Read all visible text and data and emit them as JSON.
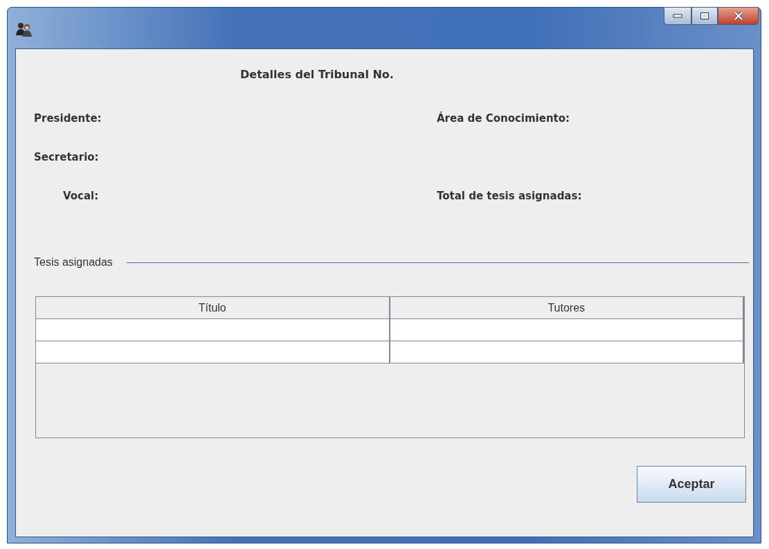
{
  "window": {
    "title_bar_buttons": [
      {
        "kind": "minimize"
      },
      {
        "kind": "maximize"
      },
      {
        "kind": "close"
      }
    ]
  },
  "heading": "Detalles del Tribunal No.",
  "field_rows": [
    {
      "left": {
        "label": "Presidente:"
      },
      "right": {
        "label": "Área de Conocimiento:"
      }
    },
    {
      "left": {
        "label": "Secretario:"
      }
    },
    {
      "left": {
        "label": "Vocal:"
      },
      "right": {
        "label": "Total de tesis asignadas:"
      }
    }
  ],
  "section": {
    "title": "Tesis asignadas"
  },
  "table": {
    "columns": [
      "Título",
      "Tutores"
    ],
    "rows": [
      {
        "kind": "blank"
      },
      {
        "kind": "blank"
      }
    ]
  },
  "buttons": [
    "Aceptar"
  ]
}
